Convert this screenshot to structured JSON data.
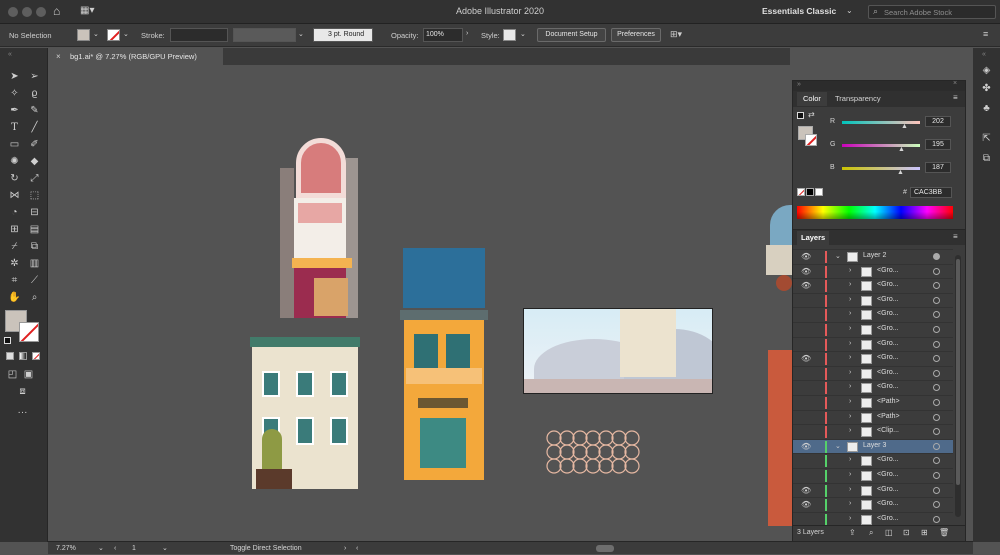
{
  "app": {
    "title": "Adobe Illustrator 2020",
    "workspace": "Essentials Classic",
    "search_placeholder": "Search Adobe Stock"
  },
  "control_bar": {
    "selection": "No Selection",
    "stroke_label": "Stroke:",
    "stroke_profile": "3 pt. Round",
    "opacity_label": "Opacity:",
    "opacity_value": "100%",
    "style_label": "Style:",
    "doc_setup": "Document Setup",
    "preferences": "Preferences"
  },
  "document_tab": {
    "label": "bg1.ai* @ 7.27% (RGB/GPU Preview)"
  },
  "status": {
    "zoom": "7.27%",
    "artboard": "1",
    "tool": "Toggle Direct Selection"
  },
  "color_panel": {
    "tabs": [
      "Color",
      "Transparency"
    ],
    "r_label": "R",
    "g_label": "G",
    "b_label": "B",
    "r": "202",
    "g": "195",
    "b": "187",
    "hex_label": "#",
    "hex": "CAC3BB",
    "colors": {
      "fill": "#cac3bb",
      "r_track": "#22c7c2",
      "g_track": "#c24bc5",
      "b_track": "#d1c25a"
    }
  },
  "layers_panel": {
    "title": "Layers",
    "footer": "3 Layers",
    "rows": [
      {
        "name": "Layer 2",
        "level": 0,
        "bar": "#e55a5a",
        "visible": true,
        "target": true
      },
      {
        "name": "<Gro...",
        "level": 1,
        "bar": "#e55a5a",
        "visible": true
      },
      {
        "name": "<Gro...",
        "level": 1,
        "bar": "#e55a5a",
        "visible": true
      },
      {
        "name": "<Gro...",
        "level": 1,
        "bar": "#e55a5a",
        "visible": false
      },
      {
        "name": "<Gro...",
        "level": 1,
        "bar": "#e55a5a",
        "visible": false
      },
      {
        "name": "<Gro...",
        "level": 1,
        "bar": "#e55a5a",
        "visible": false
      },
      {
        "name": "<Gro...",
        "level": 1,
        "bar": "#e55a5a",
        "visible": false
      },
      {
        "name": "<Gro...",
        "level": 1,
        "bar": "#e55a5a",
        "visible": true
      },
      {
        "name": "<Gro...",
        "level": 1,
        "bar": "#e55a5a",
        "visible": false
      },
      {
        "name": "<Gro...",
        "level": 1,
        "bar": "#e55a5a",
        "visible": false
      },
      {
        "name": "<Path>",
        "level": 1,
        "bar": "#e55a5a",
        "visible": false
      },
      {
        "name": "<Path>",
        "level": 1,
        "bar": "#e55a5a",
        "visible": false
      },
      {
        "name": "<Clip...",
        "level": 1,
        "bar": "#e55a5a",
        "visible": false
      },
      {
        "name": "Layer 3",
        "level": 0,
        "bar": "#55d16a",
        "visible": true,
        "selected": true
      },
      {
        "name": "<Gro...",
        "level": 1,
        "bar": "#55d16a",
        "visible": false
      },
      {
        "name": "<Gro...",
        "level": 1,
        "bar": "#55d16a",
        "visible": false
      },
      {
        "name": "<Gro...",
        "level": 1,
        "bar": "#55d16a",
        "visible": true
      },
      {
        "name": "<Gro...",
        "level": 1,
        "bar": "#55d16a",
        "visible": true
      },
      {
        "name": "<Gro...",
        "level": 1,
        "bar": "#55d16a",
        "visible": false
      }
    ]
  }
}
